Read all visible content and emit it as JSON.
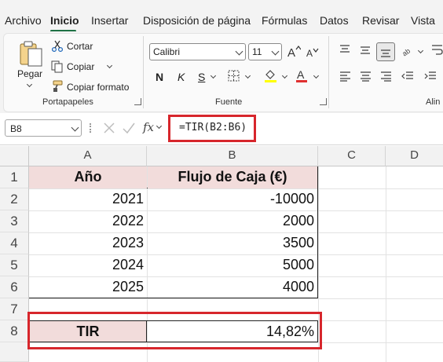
{
  "menu": {
    "tabs": [
      "Archivo",
      "Inicio",
      "Insertar",
      "Disposición de página",
      "Fórmulas",
      "Datos",
      "Revisar",
      "Vista"
    ],
    "active": "Inicio"
  },
  "ribbon": {
    "clipboard": {
      "paste": "Pegar",
      "cut": "Cortar",
      "copy": "Copiar",
      "format_painter": "Copiar formato",
      "group_label": "Portapapeles"
    },
    "font": {
      "font_name": "Calibri",
      "font_size": "11",
      "bold": "N",
      "italic": "K",
      "underline": "S",
      "group_label": "Fuente",
      "font_color": "#e03030",
      "fill_color": "#ffff00"
    },
    "alignment": {
      "group_label": "Alin"
    }
  },
  "formula_bar": {
    "name_box": "B8",
    "fx": "fx",
    "formula": "=TIR(B2:B6)"
  },
  "sheet": {
    "columns": [
      "A",
      "B",
      "C",
      "D"
    ],
    "rows": [
      "1",
      "2",
      "3",
      "4",
      "5",
      "6",
      "7",
      "8"
    ],
    "header": {
      "a": "Año",
      "b": "Flujo de Caja (€)"
    },
    "data": [
      {
        "year": "2021",
        "flow": "-10000"
      },
      {
        "year": "2022",
        "flow": "2000"
      },
      {
        "year": "2023",
        "flow": "3500"
      },
      {
        "year": "2024",
        "flow": "5000"
      },
      {
        "year": "2025",
        "flow": "4000"
      }
    ],
    "result": {
      "label": "TIR",
      "value": "14,82%"
    }
  },
  "colors": {
    "accent": "#1e7145",
    "header_fill": "#f2dcdb",
    "highlight": "#d7262c"
  }
}
